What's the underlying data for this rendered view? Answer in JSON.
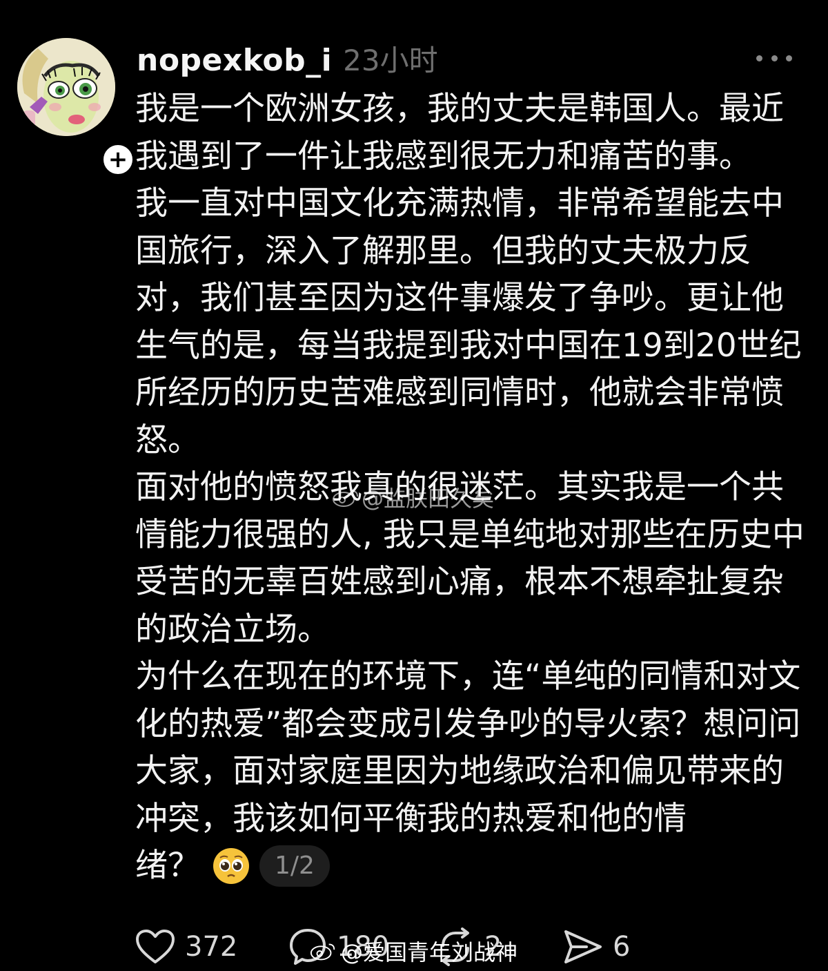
{
  "post": {
    "username": "nopexkob_i",
    "timestamp": "23小时",
    "paragraphs": [
      "我是一个欧洲女孩，我的丈夫是韩国人。最近我遇到了一件让我感到很无力和痛苦的事。",
      "我一直对中国文化充满热情，非常希望能去中国旅行，深入了解那里。但我的丈夫极力反对，我们甚至因为这件事爆发了争吵。更让他生气的是，每当我提到我对中国在19到20世纪所经历的历史苦难感到同情时，他就会非常愤怒。",
      "面对他的愤怒我真的很迷茫。其实我是一个共情能力很强的人, 我只是单纯地对那些在历史中受苦的无辜百姓感到心痛，根本不想牵扯复杂的政治立场。",
      "为什么在现在的环境下，连“单纯的同情和对文化的热爱”都会变成引发争吵的导火索？想问问大家，面对家庭里因为地缘政治和偏见带来的冲突，我该如何平衡我的热爱和他的情"
    ],
    "last_line": "绪？",
    "emoji": "pleading-face",
    "page_indicator": "1/2"
  },
  "actions": {
    "likes": "372",
    "comments": "180",
    "reposts": "2",
    "shares": "6"
  },
  "watermarks": {
    "middle": "@监朕田久矣",
    "bottom": "@爱国青年刘战神"
  },
  "icons": {
    "follow": "plus-icon",
    "more": "more-dots-icon",
    "like": "heart-icon",
    "comment": "comment-bubble-icon",
    "repost": "repost-icon",
    "share": "send-icon"
  },
  "colors": {
    "background": "#000000",
    "text": "#f2f2f2",
    "muted": "#6f6f6f"
  }
}
